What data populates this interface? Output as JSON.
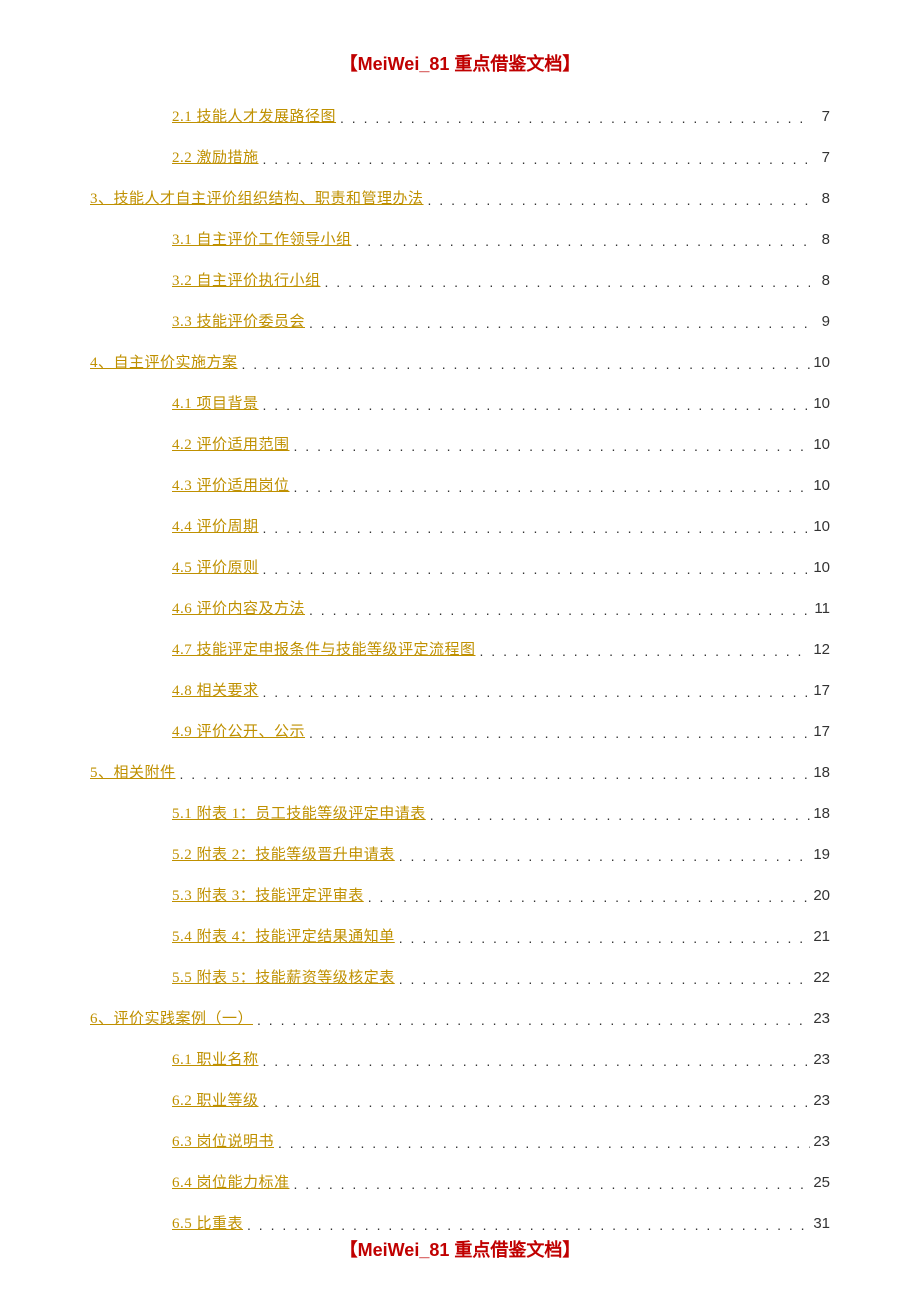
{
  "header": "【MeiWei_81 重点借鉴文档】",
  "footer": "【MeiWei_81 重点借鉴文档】",
  "toc": [
    {
      "level": 2,
      "label": "2.1 技能人才发展路径图",
      "page": "7"
    },
    {
      "level": 2,
      "label": "2.2 激励措施",
      "page": "7"
    },
    {
      "level": 1,
      "label": "3、技能人才自主评价组织结构、职责和管理办法",
      "page": "8"
    },
    {
      "level": 2,
      "label": "3.1 自主评价工作领导小组",
      "page": "8"
    },
    {
      "level": 2,
      "label": "3.2 自主评价执行小组",
      "page": "8"
    },
    {
      "level": 2,
      "label": "3.3 技能评价委员会",
      "page": "9"
    },
    {
      "level": 1,
      "label": "4、自主评价实施方案",
      "page": "10"
    },
    {
      "level": 2,
      "label": "4.1 项目背景",
      "page": "10"
    },
    {
      "level": 2,
      "label": "4.2 评价适用范围",
      "page": "10"
    },
    {
      "level": 2,
      "label": "4.3 评价适用岗位",
      "page": "10"
    },
    {
      "level": 2,
      "label": "4.4 评价周期",
      "page": "10"
    },
    {
      "level": 2,
      "label": "4.5 评价原则",
      "page": "10"
    },
    {
      "level": 2,
      "label": "4.6 评价内容及方法",
      "page": "11"
    },
    {
      "level": 2,
      "label": "4.7 技能评定申报条件与技能等级评定流程图",
      "page": "12"
    },
    {
      "level": 2,
      "label": "4.8 相关要求",
      "page": "17"
    },
    {
      "level": 2,
      "label": "4.9 评价公开、公示",
      "page": "17"
    },
    {
      "level": 1,
      "label": "5、相关附件",
      "page": "18"
    },
    {
      "level": 2,
      "label": "5.1 附表 1：员工技能等级评定申请表",
      "page": "18"
    },
    {
      "level": 2,
      "label": "5.2 附表 2：技能等级晋升申请表",
      "page": "19"
    },
    {
      "level": 2,
      "label": "5.3 附表 3：技能评定评审表",
      "page": "20"
    },
    {
      "level": 2,
      "label": "5.4 附表 4：技能评定结果通知单",
      "page": "21"
    },
    {
      "level": 2,
      "label": "5.5 附表 5：技能薪资等级核定表",
      "page": "22"
    },
    {
      "level": 1,
      "label": "6、评价实践案例（一）",
      "page": "23"
    },
    {
      "level": 2,
      "label": "6.1 职业名称",
      "page": "23"
    },
    {
      "level": 2,
      "label": "6.2 职业等级",
      "page": "23"
    },
    {
      "level": 2,
      "label": "6.3 岗位说明书",
      "page": "23"
    },
    {
      "level": 2,
      "label": "6.4 岗位能力标准",
      "page": "25"
    },
    {
      "level": 2,
      "label": "6.5 比重表",
      "page": "31"
    }
  ]
}
